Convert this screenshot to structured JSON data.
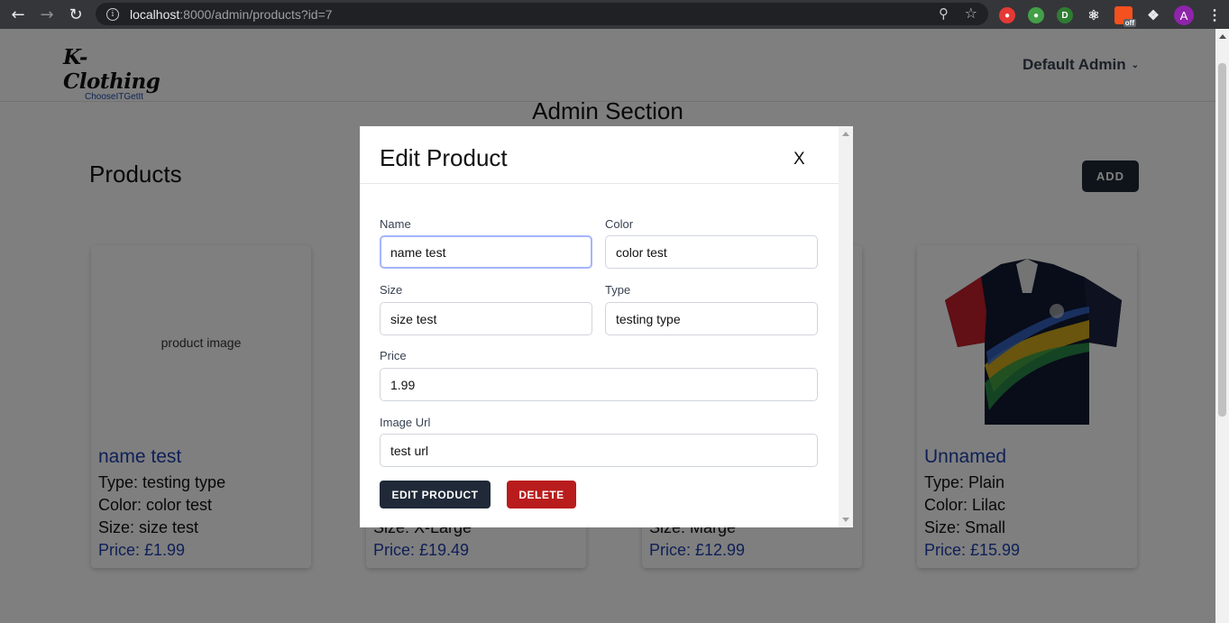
{
  "browser": {
    "url_host": "localhost",
    "url_rest": ":8000/admin/products?id=7",
    "avatar_letter": "A",
    "ext_off_label": "off"
  },
  "header": {
    "logo_main": "K-Clothing",
    "logo_sub": "ChooseITGetIt",
    "admin_menu": "Default Admin"
  },
  "page": {
    "admin_title": "Admin Section",
    "products_title": "Products",
    "add_label": "ADD"
  },
  "products": [
    {
      "image_alt": "product image",
      "name": "name test",
      "type": "Type: testing type",
      "color": "Color: color test",
      "size": "Size: size test",
      "price": "Price: £1.99"
    },
    {
      "size": "Size: X-Large",
      "price": "Price: £19.49"
    },
    {
      "size": "Size: Marge",
      "price": "Price: £12.99"
    },
    {
      "name": "Unnamed",
      "type": "Type: Plain",
      "color": "Color: Lilac",
      "size": "Size: Small",
      "price": "Price: £15.99"
    }
  ],
  "modal": {
    "title": "Edit Product",
    "close_label": "X",
    "fields": {
      "name": {
        "label": "Name",
        "value": "name test"
      },
      "color": {
        "label": "Color",
        "value": "color test"
      },
      "size": {
        "label": "Size",
        "value": "size test"
      },
      "type": {
        "label": "Type",
        "value": "testing type"
      },
      "price": {
        "label": "Price",
        "value": "1.99"
      },
      "image_url": {
        "label": "Image Url",
        "value": "test url"
      }
    },
    "edit_label": "EDIT PRODUCT",
    "delete_label": "DELETE"
  },
  "colors": {
    "primary_dark": "#1f2937",
    "danger": "#b91c1c",
    "link_blue": "#1e40af",
    "focus_ring": "#a5b4fc"
  }
}
